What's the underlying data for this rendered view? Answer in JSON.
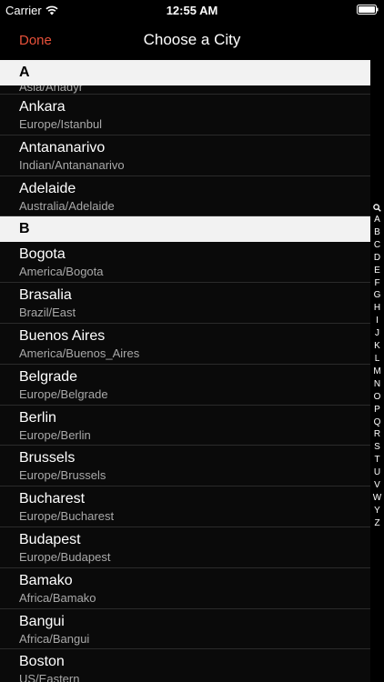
{
  "status": {
    "carrier": "Carrier",
    "time": "12:55 AM"
  },
  "nav": {
    "done_label": "Done",
    "title": "Choose a City"
  },
  "sections": [
    {
      "header": "A",
      "partial_sub": "Asia/Anadyr",
      "rows": [
        {
          "title": "Ankara",
          "sub": "Europe/Istanbul"
        },
        {
          "title": "Antananarivo",
          "sub": "Indian/Antananarivo"
        },
        {
          "title": "Adelaide",
          "sub": "Australia/Adelaide"
        }
      ]
    },
    {
      "header": "B",
      "rows": [
        {
          "title": "Bogota",
          "sub": "America/Bogota"
        },
        {
          "title": "Brasalia",
          "sub": "Brazil/East"
        },
        {
          "title": "Buenos Aires",
          "sub": "America/Buenos_Aires"
        },
        {
          "title": "Belgrade",
          "sub": "Europe/Belgrade"
        },
        {
          "title": "Berlin",
          "sub": "Europe/Berlin"
        },
        {
          "title": "Brussels",
          "sub": "Europe/Brussels"
        },
        {
          "title": "Bucharest",
          "sub": "Europe/Bucharest"
        },
        {
          "title": "Budapest",
          "sub": "Europe/Budapest"
        },
        {
          "title": "Bamako",
          "sub": "Africa/Bamako"
        },
        {
          "title": "Bangui",
          "sub": "Africa/Bangui"
        },
        {
          "title": "Boston",
          "sub": "US/Eastern"
        }
      ]
    }
  ],
  "index_letters": [
    "A",
    "B",
    "C",
    "D",
    "E",
    "F",
    "G",
    "H",
    "I",
    "J",
    "K",
    "L",
    "M",
    "N",
    "O",
    "P",
    "Q",
    "R",
    "S",
    "T",
    "U",
    "V",
    "W",
    "Y",
    "Z"
  ],
  "colors": {
    "accent": "#e8513a",
    "background": "#000000",
    "section_header": "#f2f2f2",
    "subtitle": "#a9a9a9"
  }
}
